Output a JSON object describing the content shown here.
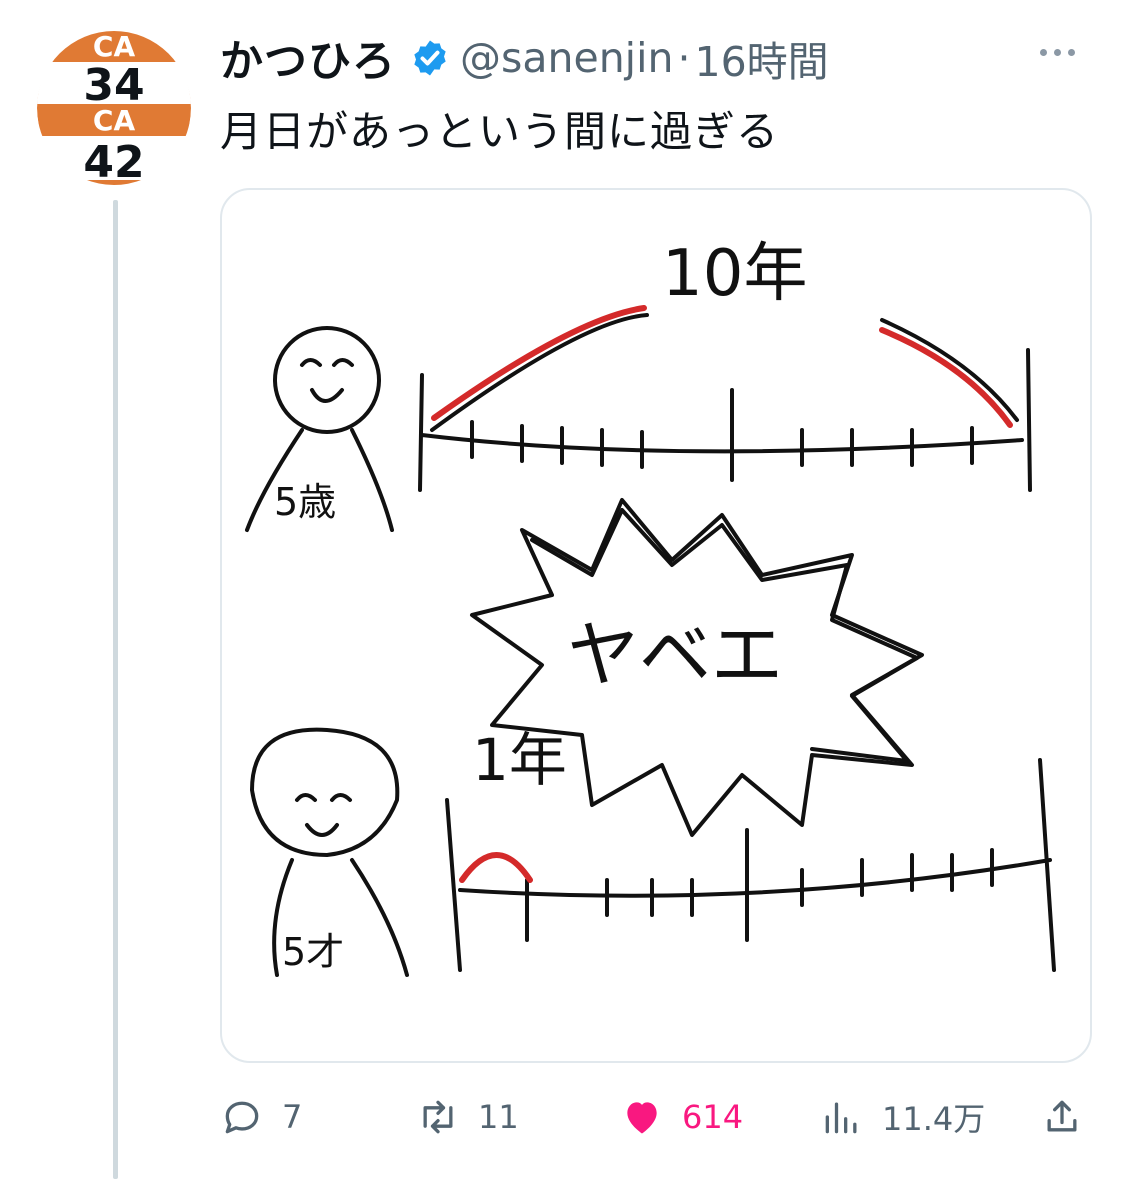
{
  "tweet": {
    "avatar": {
      "top_text": "CA",
      "top_number": "34",
      "mid_text": "CA",
      "bottom_number": "42",
      "color": "#e07a34"
    },
    "author_name": "かつひろ",
    "verified_icon": "verified-badge-icon",
    "handle": "@sanenjin",
    "separator": "·",
    "timestamp": "16時間",
    "more_icon": "more-options-icon",
    "text": "月日があっという間に過ぎる",
    "image": {
      "label_top": "10年",
      "label_exclaim": "ヤベエ",
      "label_bottom": "1年",
      "label_age_top": "5歳",
      "label_age_bottom": "5才"
    },
    "actions": {
      "replies": "7",
      "retweets": "11",
      "likes": "614",
      "views": "11.4万",
      "reply_icon": "reply-icon",
      "retweet_icon": "retweet-icon",
      "like_icon": "heart-icon",
      "views_icon": "views-icon",
      "share_icon": "share-icon"
    },
    "colors": {
      "verified": "#1d9bf0",
      "like": "#f91880",
      "muted": "#536471",
      "sketch_highlight": "#d42a2a"
    }
  }
}
